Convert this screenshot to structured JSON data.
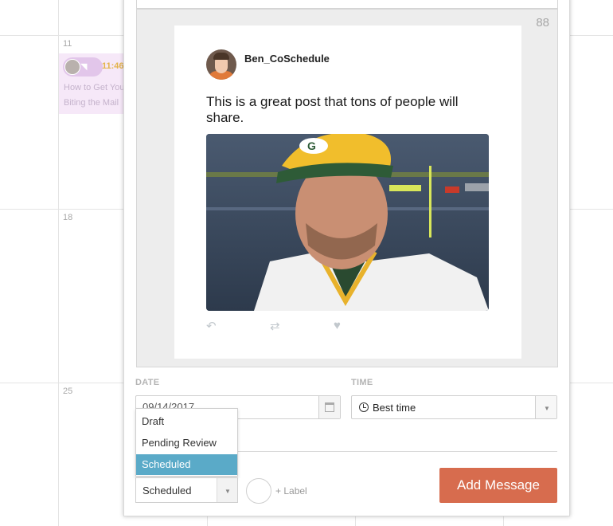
{
  "calendar": {
    "days": {
      "d11": "11",
      "d18": "18",
      "d25": "25"
    },
    "event": {
      "time": "11:46",
      "title": "How to Get Your Blog Biting the Mail"
    }
  },
  "preview": {
    "char_count": "88",
    "tweet": {
      "username": "Ben_CoSchedule",
      "text": "This is a great post that tons of people will share.",
      "actions": [
        "reply-icon",
        "retweet-icon",
        "like-icon"
      ]
    }
  },
  "fields": {
    "date_label": "DATE",
    "date_value": "09/14/2017",
    "time_label": "TIME",
    "time_value": "Best time"
  },
  "status": {
    "options": [
      "Draft",
      "Pending Review",
      "Scheduled"
    ],
    "highlighted_option": "Scheduled",
    "selected": "Scheduled"
  },
  "label": {
    "text": "+ Label"
  },
  "actions": {
    "add_message": "Add Message"
  },
  "colors": {
    "accent_button": "#d76c4e",
    "menu_highlight": "#5aaac8",
    "event_bg": "#f6e8f8"
  }
}
